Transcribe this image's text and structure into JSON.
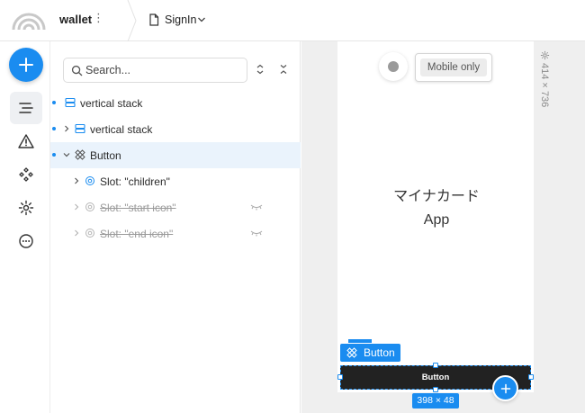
{
  "topbar": {
    "project_name": "wallet",
    "project_menu_glyph": "⋮",
    "page_name": "SignIn"
  },
  "rail": {
    "items": [
      {
        "name": "add-icon",
        "active": false
      },
      {
        "name": "layers-icon",
        "active": true
      },
      {
        "name": "warning-icon",
        "active": false
      },
      {
        "name": "components-icon",
        "active": false
      },
      {
        "name": "gear-icon",
        "active": false
      },
      {
        "name": "more-icon",
        "active": false
      }
    ]
  },
  "layers": {
    "search_placeholder": "Search...",
    "rows": [
      {
        "label": "vertical stack",
        "icon": "stack-icon",
        "struck": false
      },
      {
        "label": "vertical stack",
        "icon": "stack-icon",
        "struck": false
      },
      {
        "label": "Button",
        "icon": "component-icon",
        "struck": false
      },
      {
        "label": "Slot: \"children\"",
        "icon": "slot-icon",
        "struck": false
      },
      {
        "label": "Slot: \"start icon\"",
        "icon": "slot-icon",
        "struck": true
      },
      {
        "label": "Slot: \"end icon\"",
        "icon": "slot-icon",
        "struck": true
      }
    ]
  },
  "canvas": {
    "mobile_only_label": "Mobile only",
    "app_title_line1": "マイナカード",
    "app_title_line2": "App",
    "device_size": "414 × 736",
    "selection_label": "Button",
    "button_text": "Button",
    "selection_size": "398 × 48"
  },
  "colors": {
    "accent": "#1a8cf0",
    "selected_row": "#eaf3fc",
    "button_bg": "#222222"
  }
}
